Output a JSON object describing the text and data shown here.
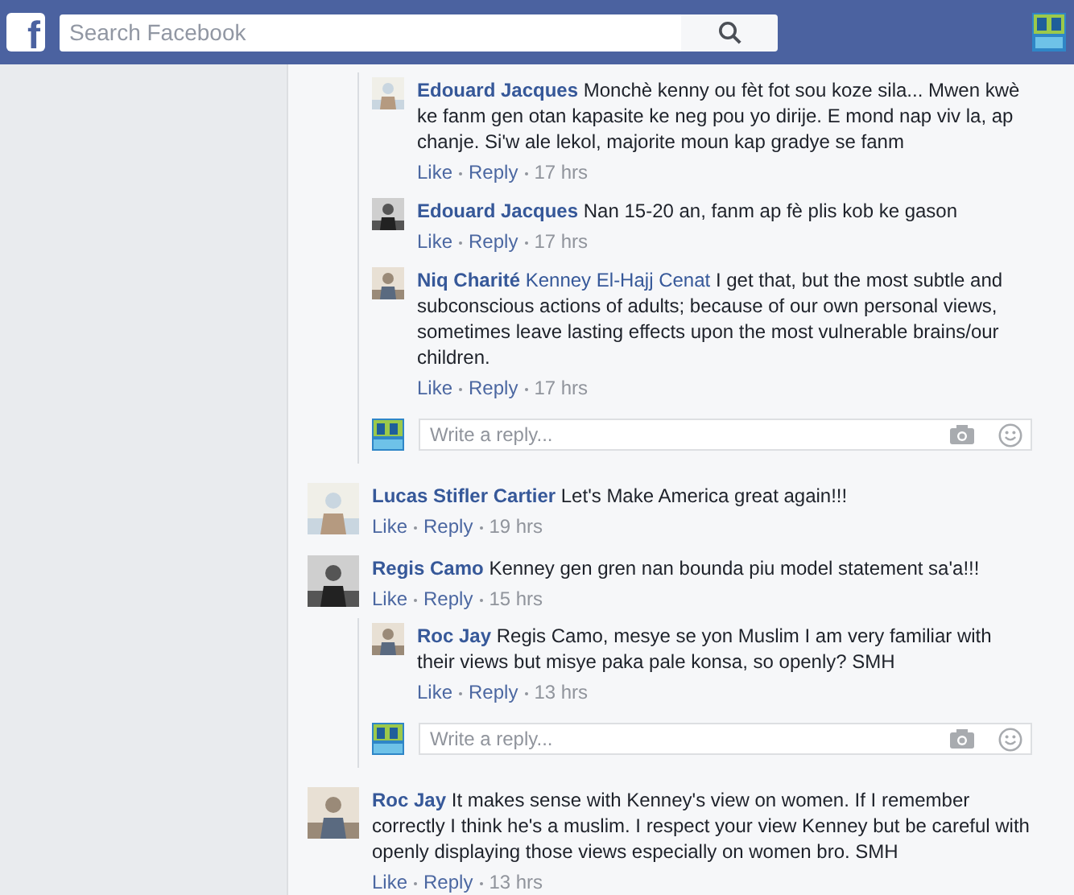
{
  "header": {
    "logo": "f",
    "search": {
      "placeholder": "Search Facebook"
    }
  },
  "threads": [
    {
      "kind": "continued",
      "replies": [
        {
          "author": "Edouard Jacques",
          "text": "Monchè kenny ou fèt fot sou koze sila... Mwen kwè ke fanm gen otan kapasite ke neg pou yo dirije. E mond nap viv la, ap chanje. Si'w ale lekol, majorite moun kap gradye se fanm",
          "like": "Like",
          "reply": "Reply",
          "time": "17 hrs"
        },
        {
          "author": "Edouard Jacques",
          "text": "Nan 15-20 an, fanm ap fè plis kob ke gason",
          "like": "Like",
          "reply": "Reply",
          "time": "17 hrs"
        },
        {
          "author": "Niq Charité",
          "mention": "Kenney El-Hajj Cenat",
          "text": "I get that, but the most subtle and subconscious actions of adults; because of our own personal views, sometimes leave lasting effects upon the most vulnerable brains/our children.",
          "like": "Like",
          "reply": "Reply",
          "time": "17 hrs"
        }
      ],
      "reply_box": {
        "placeholder": "Write a reply..."
      }
    },
    {
      "kind": "comment",
      "author": "Lucas Stifler Cartier",
      "text": "Let's Make America great again!!!",
      "like": "Like",
      "reply": "Reply",
      "time": "19 hrs"
    },
    {
      "kind": "comment",
      "author": "Regis Camo",
      "text": "Kenney gen gren nan bounda piu model statement sa'a!!!",
      "like": "Like",
      "reply": "Reply",
      "time": "15 hrs",
      "replies": [
        {
          "author": "Roc Jay",
          "text": "Regis Camo, mesye se yon Muslim I am very familiar with their views but misye paka pale konsa, so openly? SMH",
          "like": "Like",
          "reply": "Reply",
          "time": "13 hrs"
        }
      ],
      "reply_box": {
        "placeholder": "Write a reply..."
      }
    },
    {
      "kind": "comment",
      "author": "Roc Jay",
      "text": "It makes sense with Kenney's view on women. If I remember correctly I think he's a muslim. I respect your view Kenney but be careful with openly displaying those views especially on women bro. SMH",
      "like": "Like",
      "reply": "Reply",
      "time": "13 hrs"
    }
  ]
}
